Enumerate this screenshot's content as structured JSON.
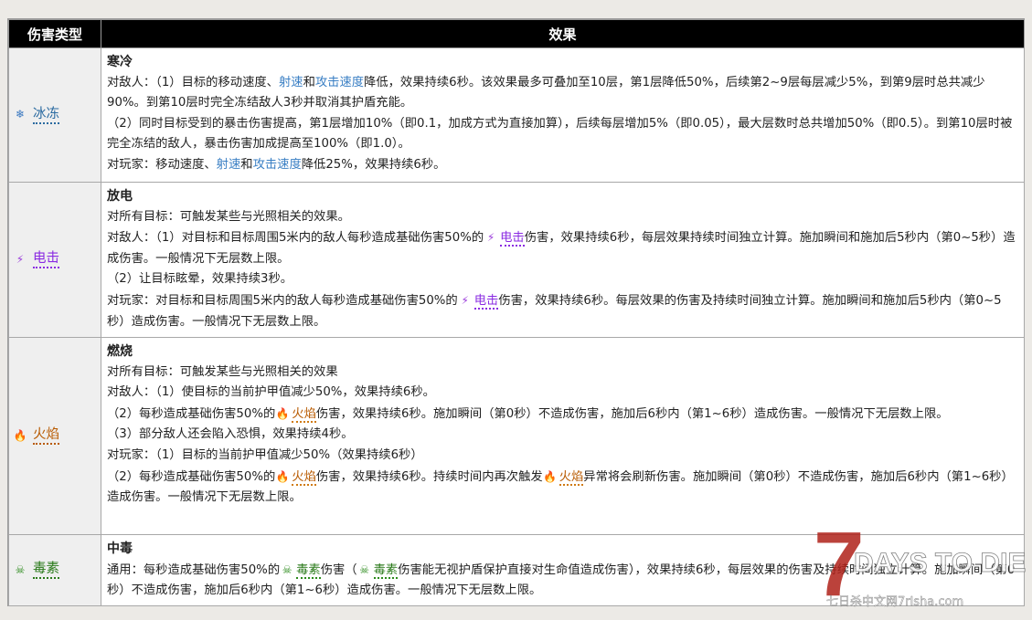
{
  "header": {
    "col_type": "伤害类型",
    "col_effect": "效果"
  },
  "rows": [
    {
      "type_label": "冰冻",
      "title": "寒冷",
      "l1_a": "对敌人：（1）目标的移动速度、",
      "l1_link1": "射速",
      "l1_and": "和",
      "l1_link2": "攻击速度",
      "l1_b": "降低，效果持续6秒。该效果最多可叠加至10层，第1层降低50%，后续第2~9层每层减少5%，到第9层时总共减少90%。到第10层时完全冻结敌人3秒并取消其护盾充能。",
      "l2": "（2）同时目标受到的暴击伤害提高，第1层增加10%（即0.1，加成方式为直接加算），后续每层增加5%（即0.05），最大层数时总共增加50%（即0.5）。到第10层时被完全冻结的敌人，暴击伤害加成提高至100%（即1.0）。",
      "l3_a": "对玩家：移动速度、",
      "l3_link1": "射速",
      "l3_and": "和",
      "l3_link2": "攻击速度",
      "l3_b": "降低25%，效果持续6秒。"
    },
    {
      "type_label": "电击",
      "title": "放电",
      "l1": "对所有目标：可触发某些与光照相关的效果。",
      "l2_a": "对敌人：（1）对目标和目标周围5米内的敌人每秒造成基础伤害50%的",
      "l2_kw": "电击",
      "l2_b": "伤害，效果持续6秒，每层效果持续时间独立计算。施加瞬间和施加后5秒内（第0~5秒）造成伤害。一般情况下无层数上限。",
      "l3": "（2）让目标眩晕，效果持续3秒。",
      "l4_a": "对玩家：对目标和目标周围5米内的敌人每秒造成基础伤害50%的",
      "l4_kw": "电击",
      "l4_b": "伤害，效果持续6秒。每层效果的伤害及持续时间独立计算。施加瞬间和施加后5秒内（第0~5秒）造成伤害。一般情况下无层数上限。"
    },
    {
      "type_label": "火焰",
      "title": "燃烧",
      "l1": "对所有目标：可触发某些与光照相关的效果",
      "l2": "对敌人：（1）使目标的当前护甲值减少50%，效果持续6秒。",
      "l3_a": "（2）每秒造成基础伤害50%的",
      "l3_kw": "火焰",
      "l3_b": "伤害，效果持续6秒。施加瞬间（第0秒）不造成伤害，施加后6秒内（第1~6秒）造成伤害。一般情况下无层数上限。",
      "l4": "（3）部分敌人还会陷入恐惧，效果持续4秒。",
      "l5": "对玩家：（1）目标的当前护甲值减少50%（效果持续6秒）",
      "l6_a": "（2）每秒造成基础伤害50%的",
      "l6_kw": "火焰",
      "l6_b": "伤害，效果持续6秒。持续时间内再次触发",
      "l6_kw2": "火焰",
      "l6_c": "异常将会刷新伤害。施加瞬间（第0秒）不造成伤害，施加后6秒内（第1~6秒）造成伤害。一般情况下无层数上限。"
    },
    {
      "type_label": "毒素",
      "title": "中毒",
      "l1_a": "通用：每秒造成基础伤害50%的",
      "l1_kw": "毒素",
      "l1_b": "伤害（",
      "l1_kw2": "毒素",
      "l1_c": "伤害能无视护盾保护直接对生命值造成伤害），效果持续6秒，每层效果的伤害及持续时间独立计算。施加瞬间（第0秒）不造成伤害，施加后6秒内（第1~6秒）造成伤害。一般情况下无层数上限。"
    }
  ],
  "icons": {
    "ice": "snowflake-icon",
    "electric": "lightning-icon",
    "fire": "flame-icon",
    "poison": "skull-icon"
  },
  "watermark": {
    "big": "7",
    "text": "DAYS TO DIE",
    "sub": "七日杀中文网7rlsha.com"
  },
  "colors": {
    "header_bg": "#000000",
    "type_bg": "#efefef",
    "link": "#3a7fc4",
    "ice": "#2a6aa0",
    "electric": "#8a2be2",
    "fire": "#b85a00",
    "poison": "#2a7a1a"
  }
}
